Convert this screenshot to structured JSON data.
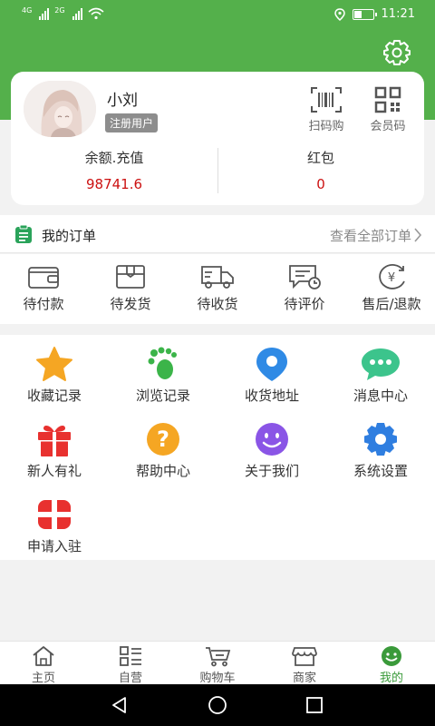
{
  "status_bar": {
    "net1": "4G",
    "net2": "2G",
    "time": "11:21",
    "battery_level": 0.4
  },
  "profile": {
    "name": "小刘",
    "badge": "注册用户",
    "scan_label": "扫码购",
    "member_code_label": "会员码",
    "balance_label": "余额.充值",
    "balance_value": "98741.6",
    "redpacket_label": "红包",
    "redpacket_value": "0"
  },
  "orders": {
    "title": "我的订单",
    "view_all": "查看全部订单",
    "items": [
      {
        "label": "待付款",
        "icon": "wallet-icon"
      },
      {
        "label": "待发货",
        "icon": "box-icon"
      },
      {
        "label": "待收货",
        "icon": "truck-icon"
      },
      {
        "label": "待评价",
        "icon": "comment-icon"
      },
      {
        "label": "售后/退款",
        "icon": "refund-icon"
      }
    ]
  },
  "services": [
    {
      "label": "收藏记录",
      "icon": "star-icon",
      "color": "#f5a623"
    },
    {
      "label": "浏览记录",
      "icon": "footprint-icon",
      "color": "#3bb449"
    },
    {
      "label": "收货地址",
      "icon": "location-pin-icon",
      "color": "#2f8ae5"
    },
    {
      "label": "消息中心",
      "icon": "chat-bubble-icon",
      "color": "#3cc48c"
    },
    {
      "label": "新人有礼",
      "icon": "gift-icon",
      "color": "#e8312f"
    },
    {
      "label": "帮助中心",
      "icon": "question-icon",
      "color": "#f5a623"
    },
    {
      "label": "关于我们",
      "icon": "smile-icon",
      "color": "#8a55e6"
    },
    {
      "label": "系统设置",
      "icon": "settings-gear-icon",
      "color": "#2f7ee0"
    },
    {
      "label": "申请入驻",
      "icon": "apply-icon",
      "color": "#e8312f"
    }
  ],
  "tabbar": [
    {
      "label": "主页",
      "icon": "home-icon",
      "active": false
    },
    {
      "label": "自营",
      "icon": "list-icon",
      "active": false
    },
    {
      "label": "购物车",
      "icon": "cart-icon",
      "active": false
    },
    {
      "label": "商家",
      "icon": "store-icon",
      "active": false
    },
    {
      "label": "我的",
      "icon": "profile-smile-icon",
      "active": true
    }
  ],
  "colors": {
    "brand_green": "#54b04b",
    "value_red": "#c11111",
    "active_tab": "#3a9a3a"
  }
}
